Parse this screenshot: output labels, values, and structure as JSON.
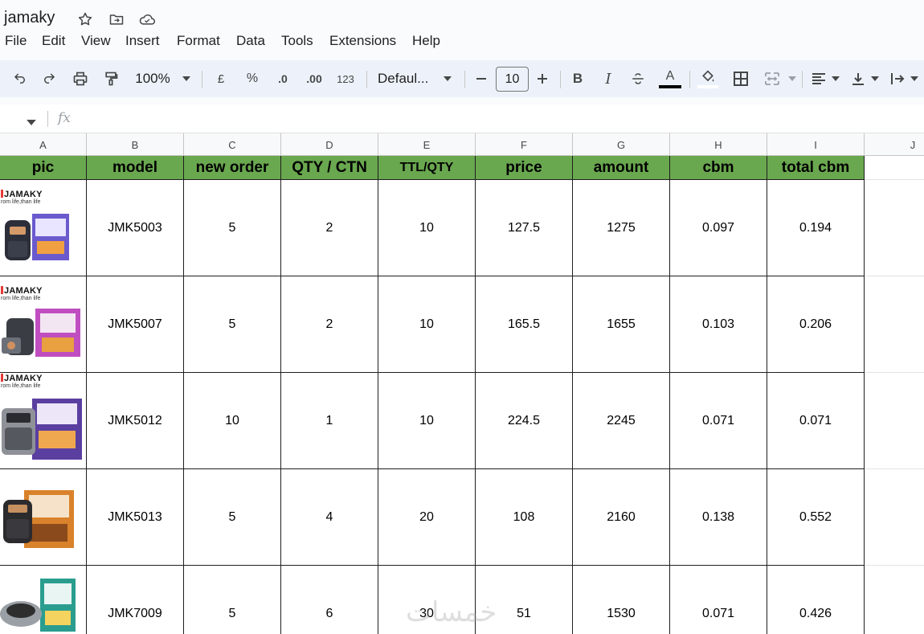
{
  "app": {
    "title": "jamaky",
    "icons": [
      "star-icon",
      "move-to-folder-icon",
      "cloud-status-icon"
    ]
  },
  "menu": [
    "File",
    "Edit",
    "View",
    "Insert",
    "Format",
    "Data",
    "Tools",
    "Extensions",
    "Help"
  ],
  "toolbar": {
    "zoom": "100%",
    "currency": "£",
    "percent": "%",
    "decrease_decimal": ".0",
    "increase_decimal": ".00",
    "number_format": "123",
    "font": "Defaul...",
    "font_size": "10"
  },
  "formula_bar": {
    "fx": "fx",
    "value": ""
  },
  "columns": [
    "A",
    "B",
    "C",
    "D",
    "E",
    "F",
    "G",
    "H",
    "I",
    "J"
  ],
  "header_row": [
    "pic",
    "model",
    "new order",
    "QTY / CTN",
    "TTL/QTY",
    "price",
    "amount",
    "cbm",
    "total cbm"
  ],
  "rows": [
    {
      "brand": "JAMAKY",
      "slogan": "rom life,than life",
      "model": "JMK5003",
      "new_order": "5",
      "qty_ctn": "2",
      "ttl_qty": "10",
      "price": "127.5",
      "amount": "1275",
      "cbm": "0.097",
      "total_cbm": "0.194"
    },
    {
      "brand": "JAMAKY",
      "slogan": "rom life,than life",
      "model": "JMK5007",
      "new_order": "5",
      "qty_ctn": "2",
      "ttl_qty": "10",
      "price": "165.5",
      "amount": "1655",
      "cbm": "0.103",
      "total_cbm": "0.206"
    },
    {
      "brand": "JAMAKY",
      "slogan": "rom life,than life",
      "model": "JMK5012",
      "new_order": "10",
      "qty_ctn": "1",
      "ttl_qty": "10",
      "price": "224.5",
      "amount": "2245",
      "cbm": "0.071",
      "total_cbm": "0.071"
    },
    {
      "brand": "",
      "slogan": "",
      "model": "JMK5013",
      "new_order": "5",
      "qty_ctn": "4",
      "ttl_qty": "20",
      "price": "108",
      "amount": "2160",
      "cbm": "0.138",
      "total_cbm": "0.552"
    },
    {
      "brand": "",
      "slogan": "",
      "model": "JMK7009",
      "new_order": "5",
      "qty_ctn": "6",
      "ttl_qty": "30",
      "price": "51",
      "amount": "1530",
      "cbm": "0.071",
      "total_cbm": "0.426"
    }
  ],
  "watermark": "خمسات",
  "colors": {
    "header_green": "#6aa84f",
    "toolbar_bg": "#edf2fa",
    "chrome_bg": "#f9fbfd"
  }
}
